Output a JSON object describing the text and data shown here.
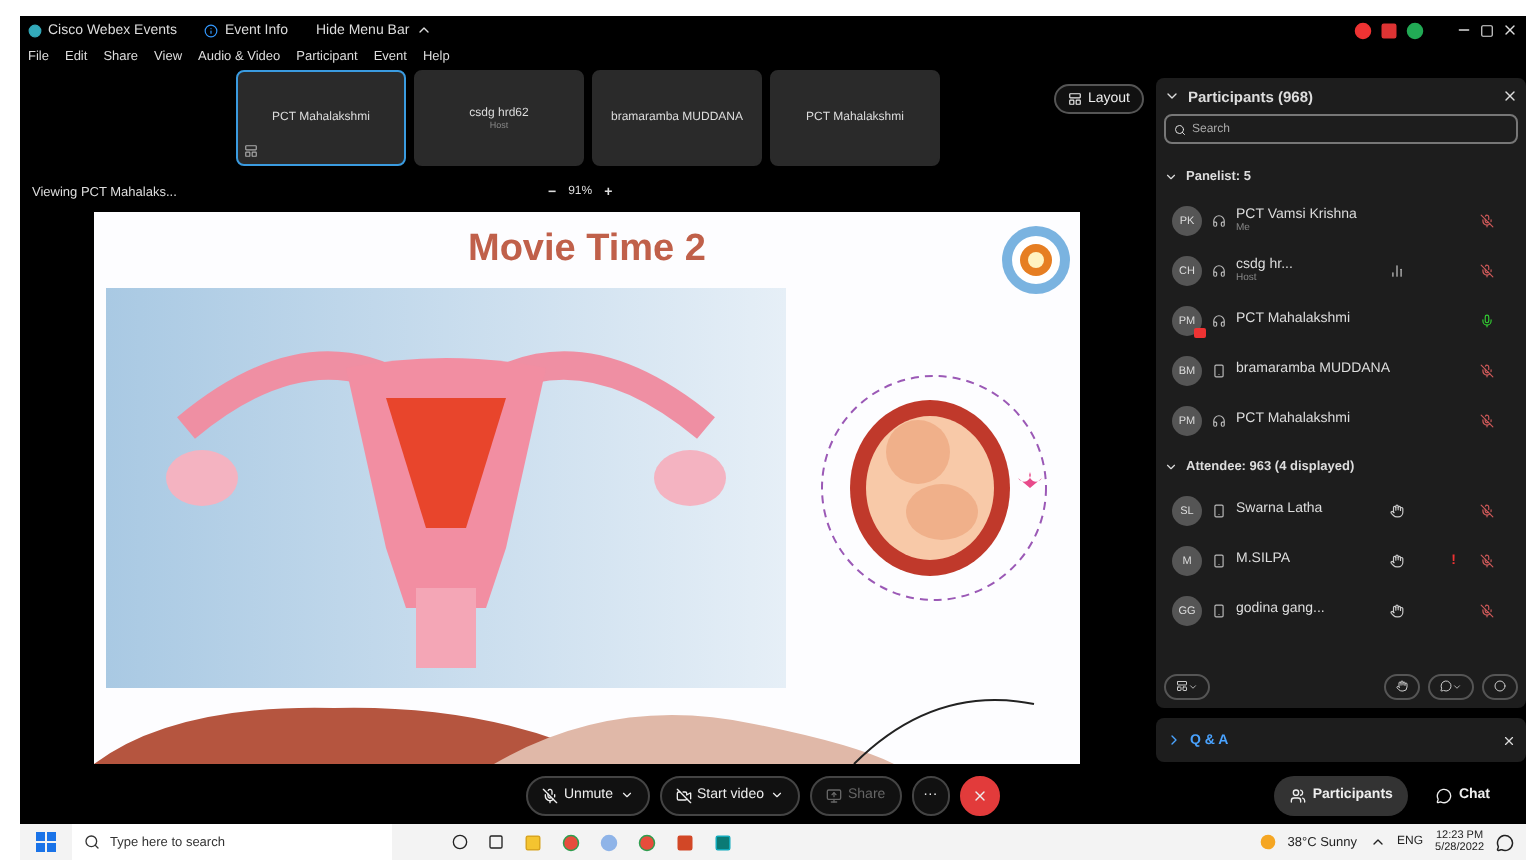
{
  "title_bar": {
    "app": "Cisco Webex Events",
    "event_info": "Event Info",
    "hide_menu": "Hide Menu Bar"
  },
  "menu": [
    "File",
    "Edit",
    "Share",
    "View",
    "Audio & Video",
    "Participant",
    "Event",
    "Help"
  ],
  "tiles": [
    {
      "name": "PCT Mahalakshmi",
      "selected": true
    },
    {
      "name": "csdg hrd62",
      "role": "Host",
      "selected": false
    },
    {
      "name": "bramaramba MUDDANA",
      "selected": false
    },
    {
      "name": "PCT Mahalakshmi",
      "selected": false
    }
  ],
  "layout_button": "Layout",
  "viewing": {
    "label": "Viewing PCT Mahalaks...",
    "zoom_out": "−",
    "zoom": "91%",
    "zoom_in": "+"
  },
  "slide": {
    "title": "Movie Time 2"
  },
  "participants": {
    "title": "Participants (968)",
    "search_placeholder": "Search",
    "groups": [
      {
        "label": "Panelist: 5",
        "rows": [
          {
            "initials": "PK",
            "name": "PCT Vamsi Krishna",
            "role": "Me",
            "kind": "headset",
            "presenting": false,
            "muted": true,
            "hand": false,
            "bars": false
          },
          {
            "initials": "CH",
            "name": "csdg hr...",
            "role": "Host",
            "kind": "headset",
            "presenting": false,
            "muted": true,
            "hand": false,
            "bars": true
          },
          {
            "initials": "PM",
            "name": "PCT Mahalakshmi",
            "kind": "headset",
            "presenting": true,
            "muted": false,
            "hand": false,
            "bars": false
          },
          {
            "initials": "BM",
            "name": "bramaramba MUDDANA",
            "kind": "phone",
            "presenting": false,
            "muted": true,
            "hand": false,
            "bars": false
          },
          {
            "initials": "PM",
            "name": "PCT Mahalakshmi",
            "kind": "headset",
            "presenting": false,
            "muted": true,
            "hand": false,
            "bars": false
          }
        ]
      },
      {
        "label": "Attendee: 963 (4 displayed)",
        "rows": [
          {
            "initials": "SL",
            "name": "Swarna Latha",
            "kind": "phone",
            "presenting": false,
            "muted": true,
            "hand": true,
            "bars": false
          },
          {
            "initials": "M",
            "name": "M.SILPA",
            "kind": "phone",
            "presenting": false,
            "muted": true,
            "hand": true,
            "bars": false,
            "alert": "!"
          },
          {
            "initials": "GG",
            "name": "godina gang...",
            "kind": "phone",
            "presenting": false,
            "muted": true,
            "hand": true,
            "bars": false
          }
        ]
      }
    ]
  },
  "qa": {
    "label": "Q & A"
  },
  "controls": [
    {
      "kind": "mic",
      "label": "Unmute",
      "disabled": false
    },
    {
      "kind": "video",
      "label": "Start video",
      "disabled": false
    },
    {
      "kind": "share",
      "label": "Share",
      "disabled": true
    },
    {
      "kind": "more",
      "label": "···",
      "disabled": false
    },
    {
      "kind": "end",
      "disabled": false
    }
  ],
  "side_controls": [
    {
      "kind": "people",
      "label": "Participants",
      "selected": true
    },
    {
      "kind": "chat",
      "label": "Chat",
      "selected": false
    }
  ],
  "taskbar": {
    "search_placeholder": "Type here to search",
    "weather": "38°C Sunny",
    "lang": "ENG",
    "time": "12:23 PM",
    "date": "5/28/2022"
  }
}
